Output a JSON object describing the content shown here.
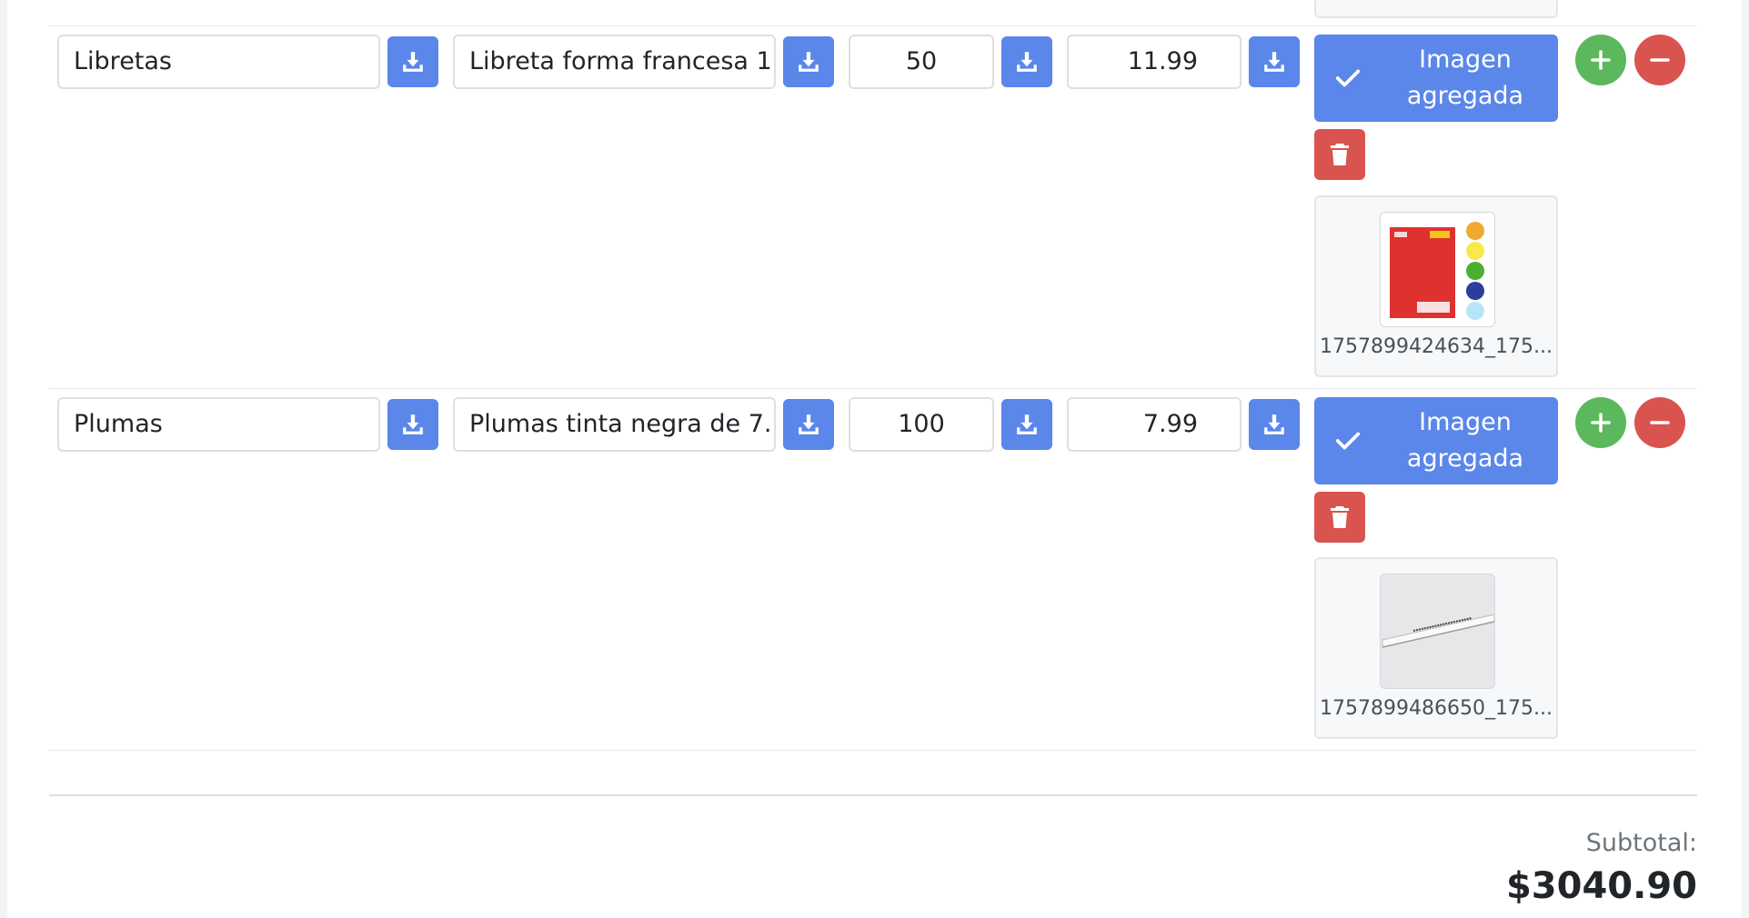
{
  "icons": {
    "download": "download-icon",
    "check": "check-icon",
    "trash": "trash-icon",
    "add": "plus-icon",
    "remove": "minus-icon"
  },
  "colors": {
    "primary": "#5b86ea",
    "danger": "#d9534f",
    "success": "#5cb85c"
  },
  "rows": [
    {
      "category": "Libretas",
      "description": "Libreta forma francesa 1...",
      "quantity": "50",
      "price": "11.99",
      "image_button_label": "Imagen agregada",
      "image_filename": "1757899424634_175..."
    },
    {
      "category": "Plumas",
      "description": "Plumas tinta negra de 7...",
      "quantity": "100",
      "price": "7.99",
      "image_button_label": "Imagen agregada",
      "image_filename": "1757899486650_175..."
    }
  ],
  "summary": {
    "subtotal_label": "Subtotal:",
    "subtotal_value": "$3040.90"
  }
}
